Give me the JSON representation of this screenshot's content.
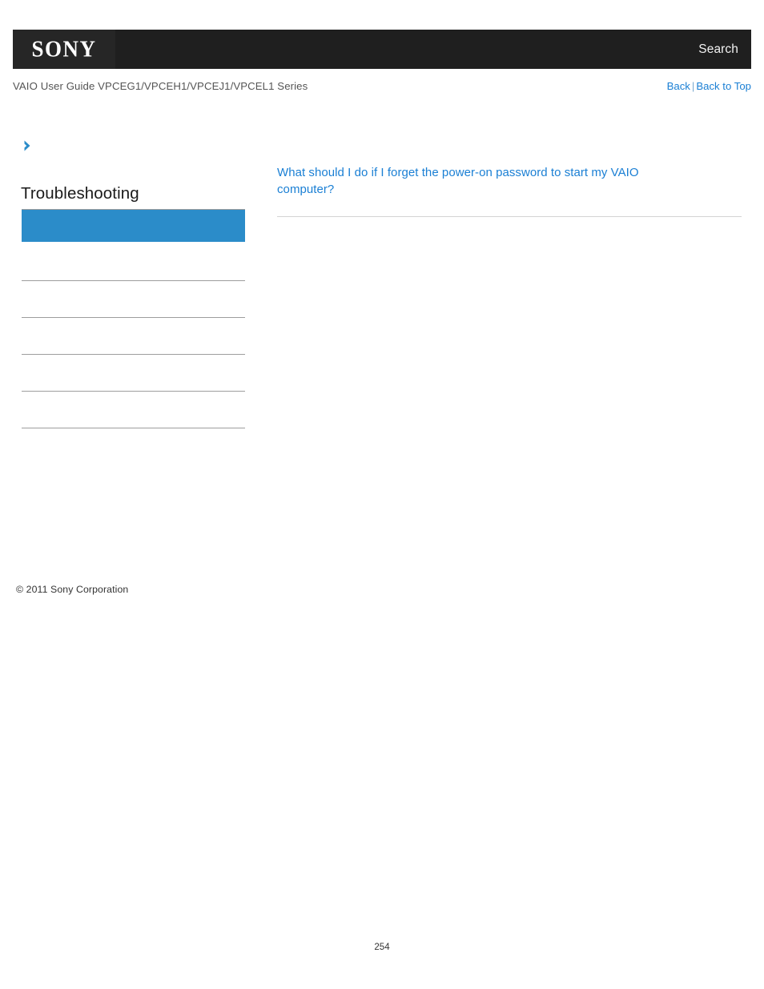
{
  "header": {
    "logo_text": "SONY",
    "search_label": "Search",
    "bar_color": "#1f1f1f",
    "logo_block_color": "#262626"
  },
  "subheader": {
    "guide_title": "VAIO User Guide VPCEG1/VPCEH1/VPCEJ1/VPCEL1 Series",
    "back_label": "Back",
    "separator": "|",
    "back_to_top_label": "Back to Top",
    "link_color": "#1a7fd4"
  },
  "sidebar": {
    "chevron_icon": "chevron-right-icon",
    "heading": "Troubleshooting",
    "active_item": {
      "label": "",
      "background": "#2b8cc9"
    },
    "items": [
      {
        "label": ""
      },
      {
        "label": ""
      },
      {
        "label": ""
      },
      {
        "label": ""
      },
      {
        "label": ""
      }
    ],
    "copyright": "© 2011 Sony Corporation"
  },
  "main": {
    "article_link": "What should I do if I forget the power-on password to start my VAIO computer?"
  },
  "footer": {
    "page_number": "254"
  }
}
